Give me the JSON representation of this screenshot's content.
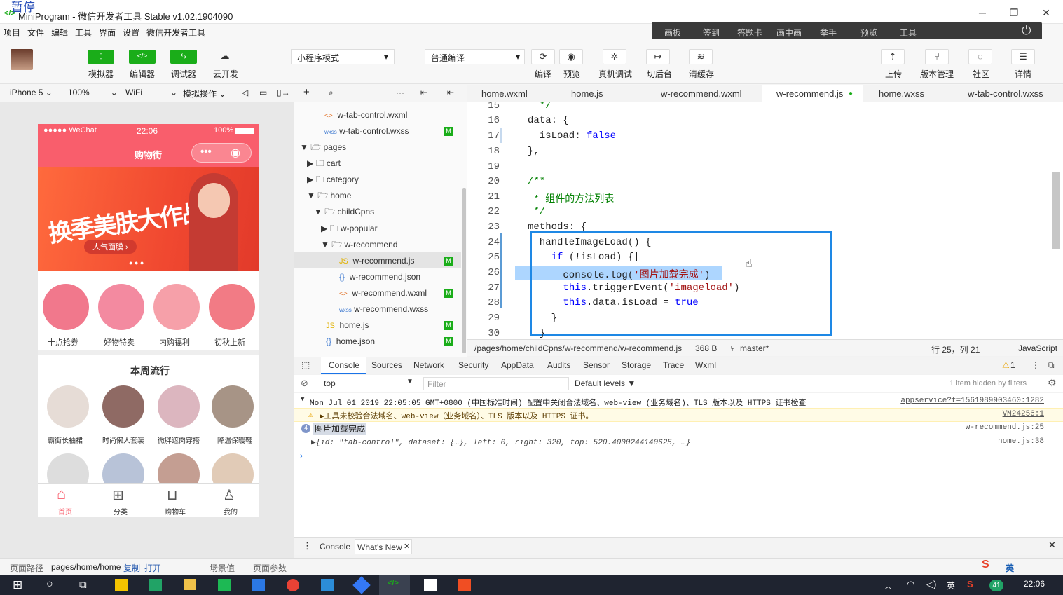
{
  "window": {
    "title": "MiniProgram - 微信开发者工具 Stable v1.02.1904090",
    "overlay": "暂停"
  },
  "menu": [
    "项目",
    "文件",
    "编辑",
    "工具",
    "界面",
    "设置",
    "微信开发者工具"
  ],
  "toplinks": [
    "画板",
    "签到",
    "答题卡",
    "画中画",
    "举手",
    "预览",
    "工具"
  ],
  "toolbar": {
    "simulator": "模拟器",
    "editor": "编辑器",
    "debugger": "调试器",
    "cloud": "云开发",
    "mode": "小程序模式",
    "compile_mode": "普通编译",
    "compile": "编译",
    "preview": "预览",
    "remote_debug": "真机调试",
    "background": "切后台",
    "clear_cache": "清缓存",
    "upload": "上传",
    "version": "版本管理",
    "community": "社区",
    "details": "详情"
  },
  "device": {
    "model": "iPhone 5",
    "zoom": "100%",
    "network": "WiFi",
    "sim_ops": "模拟操作"
  },
  "phone": {
    "carrier": "●●●●● WeChat",
    "time": "22:06",
    "battery": "100%",
    "page_title": "购物街",
    "banner_text": "换季美肤大作战",
    "banner_btn": "人气面膜 ›",
    "recommend": [
      "十点抢券",
      "好物特卖",
      "内购福利",
      "初秋上新"
    ],
    "popular_title": "本周流行",
    "popular": [
      "霸街长袖裙",
      "时尚懒人套装",
      "微胖遮肉穿搭",
      "降温保暖鞋"
    ],
    "tabbar": [
      "首页",
      "分类",
      "购物车",
      "我的"
    ]
  },
  "tree": [
    {
      "name": "w-tab-control.wxml",
      "type": "wxml",
      "m": false
    },
    {
      "name": "w-tab-control.wxss",
      "type": "wxss",
      "m": true
    },
    {
      "name": "pages",
      "type": "folder-open"
    },
    {
      "name": "cart",
      "type": "folder"
    },
    {
      "name": "category",
      "type": "folder"
    },
    {
      "name": "home",
      "type": "folder-open"
    },
    {
      "name": "childCpns",
      "type": "folder-open"
    },
    {
      "name": "w-popular",
      "type": "folder"
    },
    {
      "name": "w-recommend",
      "type": "folder-open"
    },
    {
      "name": "w-recommend.js",
      "type": "js",
      "m": true
    },
    {
      "name": "w-recommend.json",
      "type": "json",
      "m": false
    },
    {
      "name": "w-recommend.wxml",
      "type": "wxml",
      "m": true
    },
    {
      "name": "w-recommend.wxss",
      "type": "wxss",
      "m": false
    },
    {
      "name": "home.js",
      "type": "js",
      "m": true
    },
    {
      "name": "home.json",
      "type": "json",
      "m": true
    }
  ],
  "tabs": [
    "home.wxml",
    "home.js",
    "w-recommend.wxml",
    "w-recommend.js",
    "home.wxss",
    "w-tab-control.wxss"
  ],
  "code": {
    "line_numbers": [
      "15",
      "16",
      "17",
      "18",
      "19",
      "20",
      "21",
      "22",
      "23",
      "24",
      "25",
      "26",
      "27",
      "28",
      "29",
      "30"
    ]
  },
  "status": {
    "path": "/pages/home/childCpns/w-recommend/w-recommend.js",
    "size": "368 B",
    "branch": "master*",
    "position": "行 25，列 21",
    "lang": "JavaScript"
  },
  "devtools": {
    "tabs": [
      "Console",
      "Sources",
      "Network",
      "Security",
      "AppData",
      "Audits",
      "Sensor",
      "Storage",
      "Trace",
      "Wxml"
    ],
    "warn_count": "1",
    "context": "top",
    "filter": "Filter",
    "levels": "Default levels ▼",
    "hidden": "1 item hidden by filters"
  },
  "console": {
    "line1": "Mon Jul 01 2019 22:05:05 GMT+0800 (中国标准时间) 配置中关闭合法域名、web-view (业务域名)、TLS 版本以及 HTTPS 证书检查",
    "line1_src": "appservice?t=1561989903460:1282",
    "line2": "▶工具未校验合法域名、web-view（业务域名）、TLS 版本以及 HTTPS 证书。",
    "line2_src": "VM24256:1",
    "line3": "图片加载完成",
    "line3_count": "4",
    "line3_src": "w-recommend.js:25",
    "line4": "▶{id: \"tab-control\", dataset: {…}, left: 0, right: 320, top: 520.4000244140625, …}",
    "line4_src": "home.js:38"
  },
  "drawer": {
    "console": "Console",
    "whats_new": "What's New"
  },
  "pathbar": {
    "label": "页面路径",
    "path": "pages/home/home",
    "copy": "复制",
    "open": "打开",
    "scene": "场景值",
    "params": "页面参数"
  },
  "taskbar": {
    "time": "22:06",
    "ime": "英",
    "badge": "41"
  }
}
